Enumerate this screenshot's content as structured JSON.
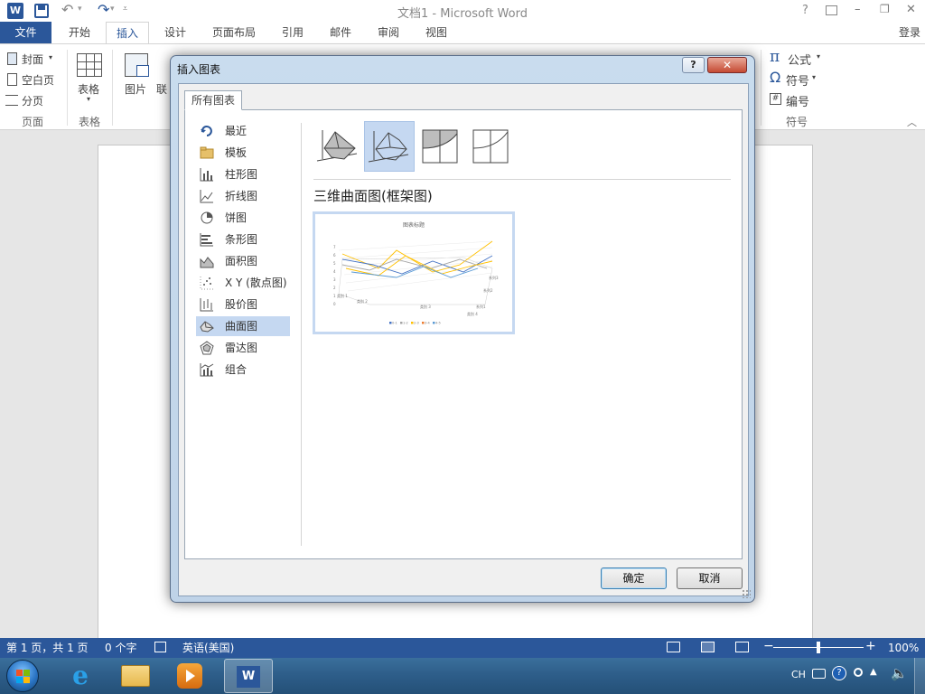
{
  "window": {
    "title": "文档1 - Microsoft Word",
    "login": "登录"
  },
  "titlebar_buttons": {
    "help": "?",
    "minimize": "–",
    "restore": "❐",
    "close": "✕"
  },
  "tabs": [
    {
      "label": "文件",
      "active": false,
      "file": true
    },
    {
      "label": "开始",
      "active": false
    },
    {
      "label": "插入",
      "active": true
    },
    {
      "label": "设计",
      "active": false
    },
    {
      "label": "页面布局",
      "active": false
    },
    {
      "label": "引用",
      "active": false
    },
    {
      "label": "邮件",
      "active": false
    },
    {
      "label": "审阅",
      "active": false
    },
    {
      "label": "视图",
      "active": false
    }
  ],
  "ribbon": {
    "pages": {
      "cover": "封面",
      "blank": "空白页",
      "break": "分页",
      "group": "页面"
    },
    "table": {
      "label": "表格",
      "group": "表格"
    },
    "pictures": {
      "label": "图片",
      "online_partial": "联"
    },
    "symbols": {
      "equation": "公式",
      "symbol": "符号",
      "number": "编号",
      "group": "符号"
    }
  },
  "dialog": {
    "title": "插入图表",
    "tab": "所有图表",
    "categories": [
      {
        "label": "最近",
        "icon": "recent-icon",
        "selected": false
      },
      {
        "label": "模板",
        "icon": "folder-icon",
        "selected": false
      },
      {
        "label": "柱形图",
        "icon": "column-chart-icon",
        "selected": false
      },
      {
        "label": "折线图",
        "icon": "line-chart-icon",
        "selected": false
      },
      {
        "label": "饼图",
        "icon": "pie-chart-icon",
        "selected": false
      },
      {
        "label": "条形图",
        "icon": "bar-chart-icon",
        "selected": false
      },
      {
        "label": "面积图",
        "icon": "area-chart-icon",
        "selected": false
      },
      {
        "label": "X Y (散点图)",
        "icon": "scatter-chart-icon",
        "selected": false
      },
      {
        "label": "股价图",
        "icon": "stock-chart-icon",
        "selected": false
      },
      {
        "label": "曲面图",
        "icon": "surface-chart-icon",
        "selected": true
      },
      {
        "label": "雷达图",
        "icon": "radar-chart-icon",
        "selected": false
      },
      {
        "label": "组合",
        "icon": "combo-chart-icon",
        "selected": false
      }
    ],
    "subtypes": [
      {
        "name": "3d-surface-icon",
        "selected": false
      },
      {
        "name": "wireframe-3d-surface-icon",
        "selected": true
      },
      {
        "name": "contour-icon",
        "selected": false
      },
      {
        "name": "wireframe-contour-icon",
        "selected": false
      }
    ],
    "selected_type_title": "三维曲面图(框架图)",
    "preview": {
      "title": "图表标题",
      "y_ticks": [
        "7",
        "6",
        "5",
        "4",
        "3",
        "2",
        "1",
        "0"
      ],
      "x_labels": [
        "类别 1",
        "类别 2",
        "类别 3",
        "类别 4"
      ],
      "depth_labels": [
        "系列3",
        "系列2",
        "系列1"
      ],
      "legend": [
        "0-1",
        "1-2",
        "2-3",
        "3-4",
        "4-5"
      ],
      "legend_colors": [
        "#4472c4",
        "#a5a5a5",
        "#ffc000",
        "#ed7d31",
        "#5b9bd5"
      ]
    },
    "ok": "确定",
    "cancel": "取消"
  },
  "status": {
    "page": "第 1 页，共 1 页",
    "words": "0 个字",
    "language": "英语(美国)",
    "zoom": "100%",
    "zoom_fraction": 0.5
  },
  "taskbar": {
    "lang": "CH"
  },
  "colors": {
    "accent": "#2b579a",
    "selected_bg": "#c5d8f1"
  }
}
